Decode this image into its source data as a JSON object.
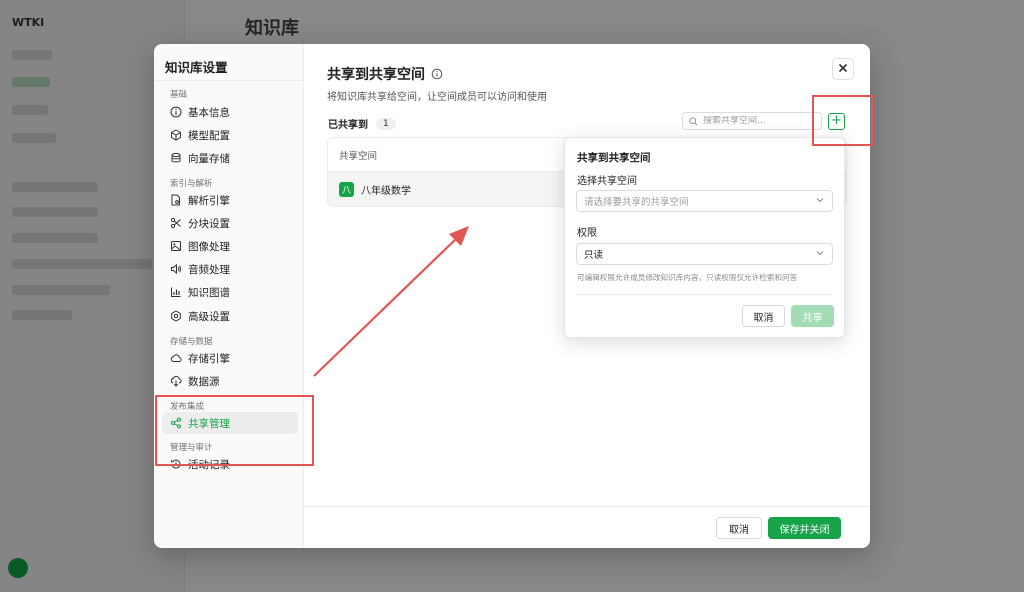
{
  "background": {
    "logo": "WTKI",
    "title": "知识库"
  },
  "nav": {
    "title": "知识库设置",
    "groups": {
      "basic": "基础",
      "index": "索引与解析",
      "storage": "存储与数据",
      "publish": "发布集成",
      "manage": "管理与审计"
    },
    "items": {
      "basic_info": "基本信息",
      "model_config": "模型配置",
      "vector_storage": "向量存储",
      "parse_engine": "解析引擎",
      "chunk_settings": "分块设置",
      "image_processing": "图像处理",
      "audio_processing": "音频处理",
      "knowledge_graph": "知识图谱",
      "advanced_settings": "高级设置",
      "storage_engine": "存储引擎",
      "data_source": "数据源",
      "share_management": "共享管理",
      "activity_log": "活动记录"
    }
  },
  "main": {
    "title": "共享到共享空间",
    "description": "将知识库共享给空间，让空间成员可以访问和使用",
    "shared_label": "已共享到",
    "shared_count": "1",
    "search_placeholder": "搜索共享空间...",
    "add_symbol": "+",
    "table": {
      "header": "共享空间",
      "rows": [
        {
          "avatar": "八",
          "name": "八年级数学"
        }
      ]
    },
    "footer": {
      "cancel": "取消",
      "save_close": "保存并关闭"
    }
  },
  "popover": {
    "title": "共享到共享空间",
    "space_label": "选择共享空间",
    "space_placeholder": "请选择要共享的共享空间",
    "permission_label": "权限",
    "permission_value": "只读",
    "hint": "可编辑权限允许成员修改知识库内容，只读权限仅允许检索和问答",
    "cancel": "取消",
    "share": "共享"
  },
  "colors": {
    "accent": "#16a34a",
    "annotation": "#e25555"
  }
}
